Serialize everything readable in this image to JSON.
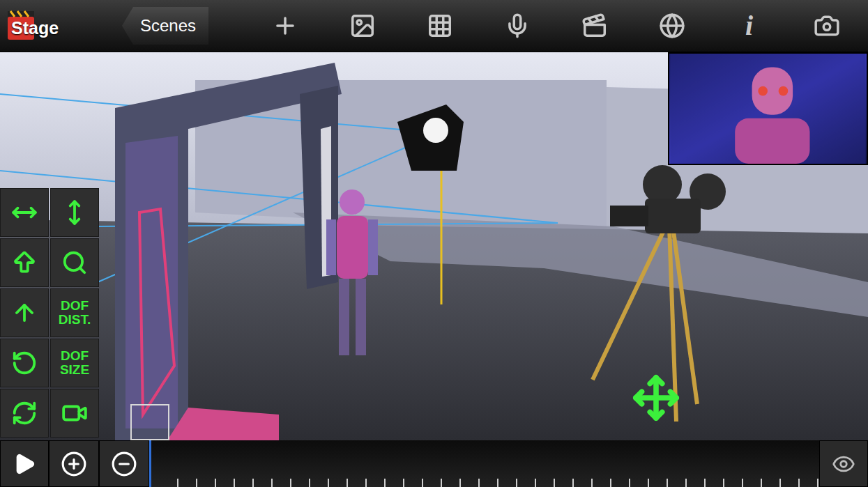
{
  "app": {
    "title": "Stage"
  },
  "nav": {
    "back": "Scenes"
  },
  "toolbar": {
    "info": "i"
  },
  "tools": [
    {
      "kind": "icon"
    },
    {
      "kind": "icon"
    },
    {
      "kind": "icon"
    },
    {
      "kind": "icon"
    },
    {
      "kind": "icon"
    },
    {
      "kind": "text",
      "label": "DOF DIST."
    },
    {
      "kind": "icon"
    },
    {
      "kind": "text",
      "label": "DOF SIZE"
    },
    {
      "kind": "icon"
    },
    {
      "kind": "icon"
    }
  ]
}
